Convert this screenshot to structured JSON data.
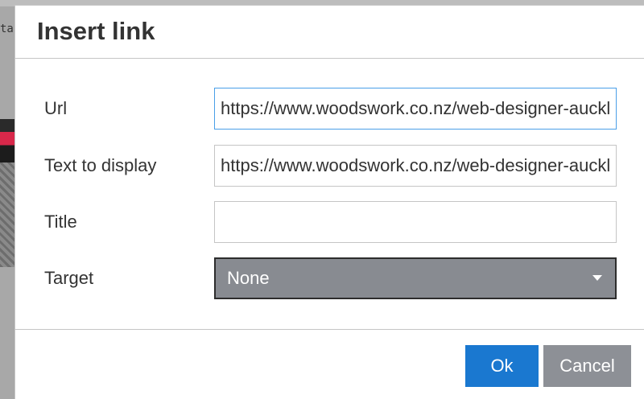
{
  "background": {
    "fragment_text": "ta"
  },
  "dialog": {
    "title": "Insert link",
    "fields": {
      "url": {
        "label": "Url",
        "value": "https://www.woodswork.co.nz/web-designer-auckland/"
      },
      "text_to_display": {
        "label": "Text to display",
        "value": "https://www.woodswork.co.nz/web-designer-auckland/"
      },
      "title": {
        "label": "Title",
        "value": ""
      },
      "target": {
        "label": "Target",
        "selected": "None"
      }
    },
    "buttons": {
      "ok_label": "Ok",
      "cancel_label": "Cancel"
    }
  },
  "colors": {
    "primary_button": "#1a78d0",
    "secondary_button": "#8d9096",
    "select_background": "#888b91",
    "focus_border": "#4a9fe8"
  }
}
